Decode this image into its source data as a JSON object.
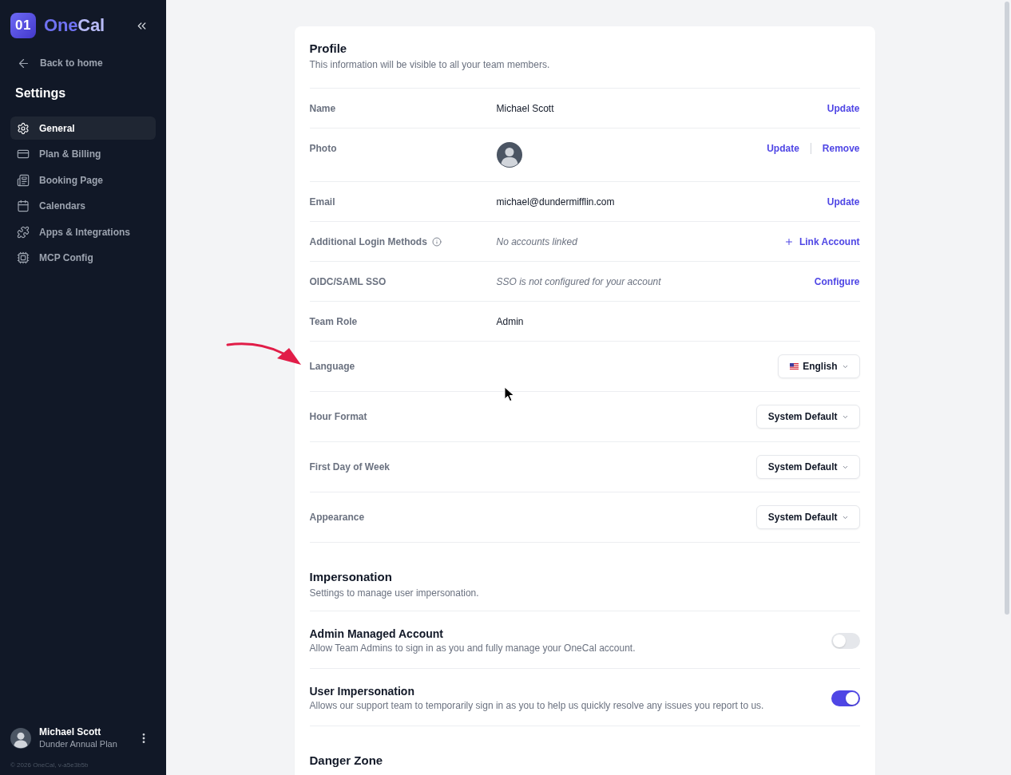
{
  "sidebar": {
    "brand": {
      "mark": "01",
      "name_parts": [
        "One",
        "Cal"
      ]
    },
    "back_link": "Back to home",
    "heading": "Settings",
    "items": [
      {
        "label": "General",
        "selected": true
      },
      {
        "label": "Plan & Billing",
        "selected": false
      },
      {
        "label": "Booking Page",
        "selected": false
      },
      {
        "label": "Calendars",
        "selected": false
      },
      {
        "label": "Apps & Integrations",
        "selected": false
      },
      {
        "label": "MCP Config",
        "selected": false
      }
    ],
    "user": {
      "name": "Michael Scott",
      "plan": "Dunder Annual Plan"
    },
    "footer": "© 2026 OneCal, v-a5e3b5b"
  },
  "profile": {
    "title": "Profile",
    "subtitle": "This information will be visible to all your team members.",
    "rows": [
      {
        "kind": "text",
        "label": "Name",
        "value": "Michael Scott",
        "actions": [
          {
            "kind": "link",
            "label": "Update"
          }
        ]
      },
      {
        "kind": "photo",
        "label": "Photo",
        "actions": [
          {
            "kind": "link",
            "label": "Update"
          },
          {
            "kind": "link",
            "label": "Remove"
          }
        ]
      },
      {
        "kind": "text",
        "label": "Email",
        "value": "michael@dundermifflin.com",
        "actions": [
          {
            "kind": "link",
            "label": "Update"
          }
        ]
      },
      {
        "kind": "note",
        "label": "Additional Login Methods",
        "info": true,
        "value": "No accounts linked",
        "actions": [
          {
            "kind": "add",
            "label": "Link Account"
          }
        ]
      },
      {
        "kind": "note",
        "label": "OIDC/SAML SSO",
        "value": "SSO is not configured for your account",
        "actions": [
          {
            "kind": "link",
            "label": "Configure"
          }
        ]
      },
      {
        "kind": "text",
        "label": "Team Role",
        "value": "Admin"
      },
      {
        "kind": "select",
        "label": "Language",
        "value": "English",
        "flag": true
      },
      {
        "kind": "select",
        "label": "Hour Format",
        "value": "System Default"
      },
      {
        "kind": "select",
        "label": "First Day of Week",
        "value": "System Default"
      },
      {
        "kind": "select",
        "label": "Appearance",
        "value": "System Default"
      }
    ]
  },
  "impersonation": {
    "title": "Impersonation",
    "subtitle": "Settings to manage user impersonation.",
    "settings": [
      {
        "title": "Admin Managed Account",
        "description": "Allow Team Admins to sign in as you and fully manage your OneCal account.",
        "on": false
      },
      {
        "title": "User Impersonation",
        "description": "Allows our support team to temporarily sign in as you to help us quickly resolve any issues you report to us.",
        "on": true
      }
    ]
  },
  "danger_zone": {
    "title": "Danger Zone"
  }
}
